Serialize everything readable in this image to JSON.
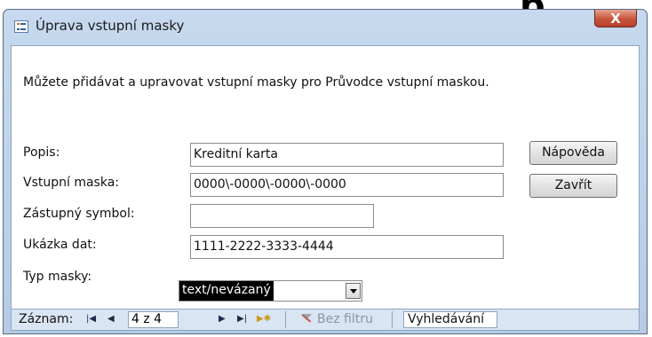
{
  "window": {
    "title": "Úprava vstupní masky",
    "close_label": "X",
    "icon": "form-icon"
  },
  "intro_text": "Můžete přidávat a upravovat vstupní masky pro Průvodce vstupní maskou.",
  "fields": {
    "popis": {
      "label": "Popis:",
      "value": "Kreditní karta"
    },
    "vstupni_maska": {
      "label": "Vstupní maska:",
      "value": "0000\\-0000\\-0000\\-0000"
    },
    "zastupny_symbol": {
      "label": "Zástupný symbol:",
      "value": ""
    },
    "ukazka_dat": {
      "label": "Ukázka dat:",
      "value": "1111-2222-3333-4444"
    },
    "typ_masky": {
      "label": "Typ masky:",
      "value": "text/nevázaný"
    }
  },
  "buttons": {
    "help": "Nápověda",
    "close": "Zavřít"
  },
  "navigation": {
    "label": "Záznam:",
    "current_record": "4 z 4",
    "filter_label": "Bez filtru",
    "search_label": "Vyhledávání",
    "icons": [
      "first-record-icon",
      "previous-record-icon",
      "next-record-icon",
      "last-record-icon",
      "new-record-icon",
      "filter-icon"
    ]
  },
  "colors": {
    "title_gradient_top": "#c6d9ee",
    "close_button": "#c8533b",
    "selection_bg": "#000000",
    "navbar_bg": "#d9e5f3"
  }
}
